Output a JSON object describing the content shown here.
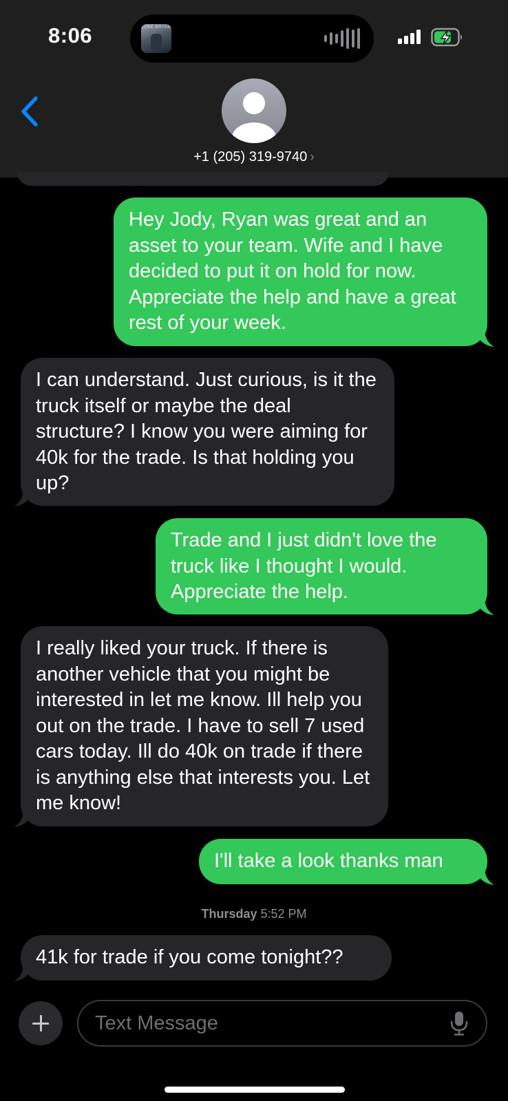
{
  "status_bar": {
    "time": "8:06"
  },
  "now_playing": {
    "album_label": "LUKE BRYAN"
  },
  "header": {
    "contact": "+1 (205) 319-9740",
    "chevron": "›"
  },
  "messages": [
    {
      "direction": "sent",
      "text": "Hey Jody, Ryan was great and an asset to your team. Wife and I have decided to put it on hold for now. Appreciate the help and have a great rest of your week."
    },
    {
      "direction": "received",
      "text": "I can understand. Just curious, is it the truck itself or maybe the deal structure? I know you were aiming for 40k for the trade. Is that holding you up?"
    },
    {
      "direction": "sent",
      "text": "Trade and I just didn't love the truck like I thought I would. Appreciate the help."
    },
    {
      "direction": "received",
      "text": "I really liked your truck. If there is another vehicle that you might be interested in let me know. Ill help you out on the trade. I have to sell 7 used cars today. Ill do 40k on trade if there is anything else that interests you. Let me know!"
    },
    {
      "direction": "sent",
      "text": "I'll take a look thanks man"
    },
    {
      "direction": "received",
      "text": "41k for trade if you come tonight??"
    }
  ],
  "timestamp": {
    "day": "Thursday",
    "time": "5:52 PM"
  },
  "input": {
    "placeholder": "Text Message"
  },
  "colors": {
    "sent_bubble": "#34c759",
    "received_bubble": "#262629",
    "accent": "#0a84ff",
    "header_bg": "#1f1f20"
  },
  "icons": [
    "back-chevron-icon",
    "person-avatar-icon",
    "plus-icon",
    "microphone-icon",
    "signal-bars-icon",
    "battery-charging-icon",
    "waveform-icon"
  ]
}
